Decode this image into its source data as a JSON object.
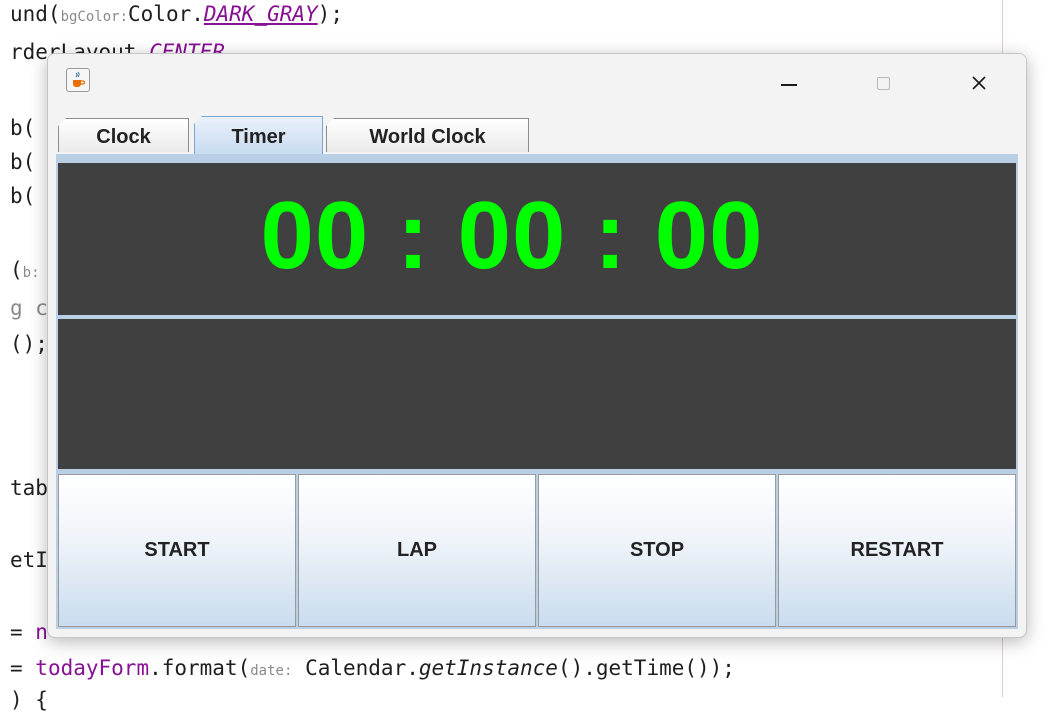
{
  "ide": {
    "lines": [
      {
        "pre": "und(",
        "hint": "bgColor:",
        "post": "Color.",
        "konst": "DARK_GRAY",
        "end": ");"
      },
      {
        "pre": "rderLayout.",
        "konst": "CENTER",
        "end": ",   "
      },
      {
        "pre": "b(",
        "end": ""
      },
      {
        "pre": "b(",
        "end": ""
      },
      {
        "pre": "b(",
        "end": ""
      },
      {
        "pre": "(",
        "hint": "b:",
        "end": ""
      },
      {
        "pre": "g c",
        "end": ""
      },
      {
        "pre": "();",
        "end": ""
      },
      {
        "pre": "tab",
        "end": ""
      },
      {
        "pre": "etI",
        "end": ""
      },
      {
        "pre": "= ",
        "field": "n",
        "end": ""
      },
      {
        "pre": "= ",
        "field": "todayForm",
        "post": ".format(",
        "hint": "date:",
        "post2": "Calendar.",
        "ital": "getInstance",
        "end": "().getTime());"
      },
      {
        "pre": ") {",
        "end": ""
      }
    ]
  },
  "window": {
    "icon": "java-cup-icon",
    "minimize": "minimize-icon",
    "maximize": "maximize-icon",
    "close": "close-icon"
  },
  "tabs": [
    {
      "label": "Clock",
      "selected": false
    },
    {
      "label": "Timer",
      "selected": true
    },
    {
      "label": "World Clock",
      "selected": false
    }
  ],
  "timer": {
    "display": "00 : 00 : 00",
    "display_color": "#00ff00",
    "panel_color": "#404040"
  },
  "buttons": [
    {
      "label": "START"
    },
    {
      "label": "LAP"
    },
    {
      "label": "STOP"
    },
    {
      "label": "RESTART"
    }
  ]
}
